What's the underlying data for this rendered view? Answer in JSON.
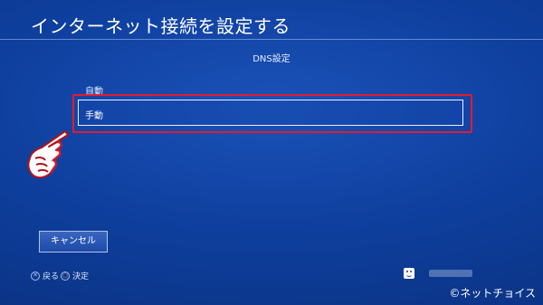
{
  "header": {
    "title": "インターネット接続を設定する"
  },
  "section": {
    "title": "DNS設定"
  },
  "options": [
    {
      "label": "自動"
    },
    {
      "label": "手動"
    }
  ],
  "buttons": {
    "cancel_label": "キャンセル"
  },
  "hints": {
    "back_label": "戻る",
    "confirm_label": "決定",
    "back_glyph": "✕",
    "confirm_glyph": "○"
  },
  "footer": {
    "copyright": "©ネットチョイス"
  },
  "colors": {
    "background": "#0e3f9e",
    "highlight": "#e31b2d"
  },
  "icons": {
    "pointer": "pointing-hand-icon",
    "user": "user-avatar-icon"
  }
}
